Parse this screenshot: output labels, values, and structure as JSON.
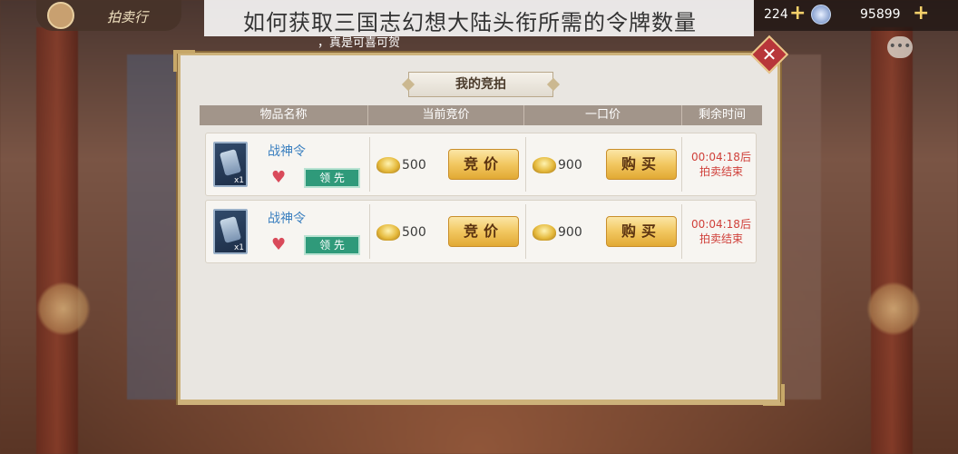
{
  "hud": {
    "left_label": "拍卖行",
    "currency1_value": "224",
    "currency1_icon": "plus-icon",
    "currency2_icon": "silver-coin-icon",
    "currency2_value": "95899",
    "currency2_plus_icon": "plus-icon"
  },
  "banner": {
    "title": "如何获取三国志幻想大陆头衔所需的令牌数量",
    "subtitle": "，真是可喜可贺"
  },
  "dialog": {
    "title": "我的竞拍",
    "close_icon": "close-icon",
    "columns": [
      "物品名称",
      "当前竞价",
      "一口价",
      "剩余时间"
    ],
    "rows": [
      {
        "item_name": "战神令",
        "item_qty": "x1",
        "lead_tag": "领 先",
        "current_bid": "500",
        "bid_button": "竞价",
        "buyout_price": "900",
        "buy_button": "购买",
        "time_line1": "00:04:18后",
        "time_line2": "拍卖结束"
      },
      {
        "item_name": "战神令",
        "item_qty": "x1",
        "lead_tag": "领 先",
        "current_bid": "500",
        "bid_button": "竞价",
        "buyout_price": "900",
        "buy_button": "购买",
        "time_line1": "00:04:18后",
        "time_line2": "拍卖结束"
      }
    ]
  },
  "colors": {
    "accent_gold": "#f2c760",
    "time_red": "#d0403a",
    "item_blue": "#3a7fbf",
    "lead_green": "#2f9a7a"
  }
}
